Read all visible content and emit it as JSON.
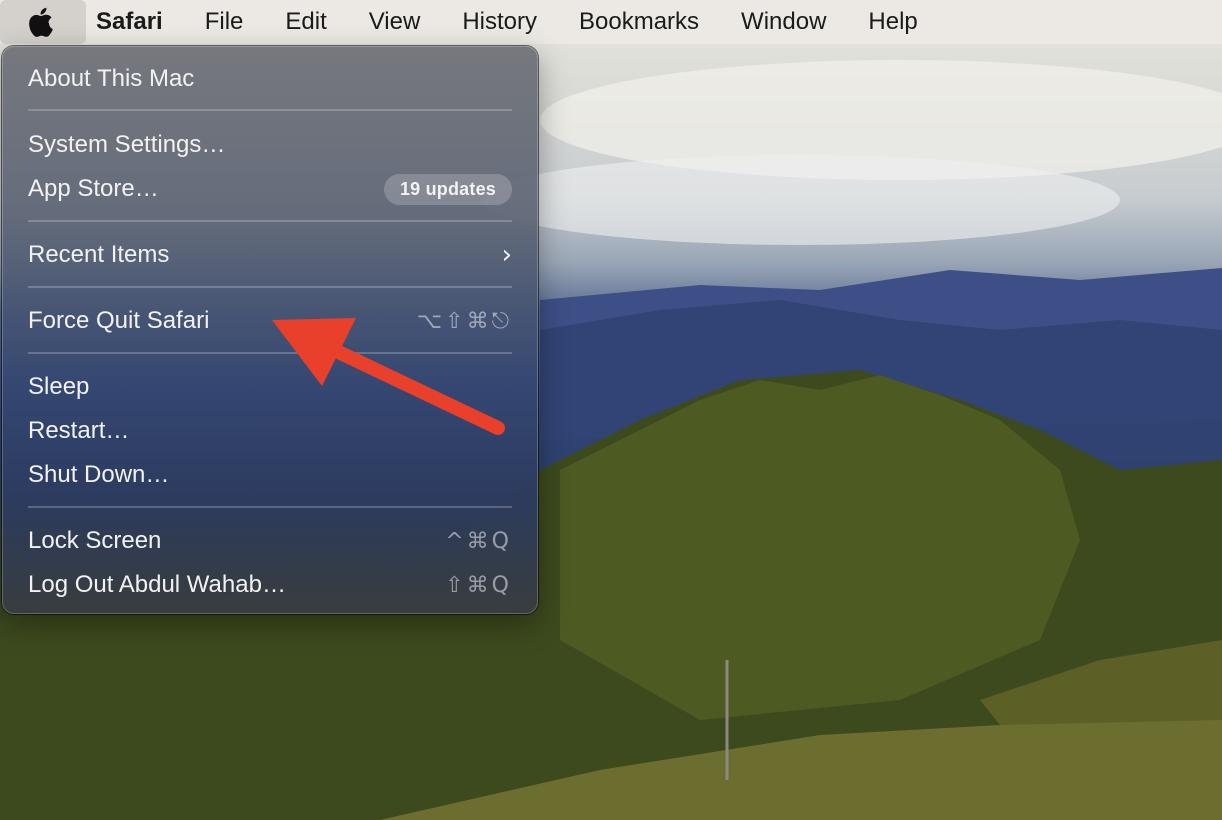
{
  "menubar": {
    "apple_icon": "apple-logo-icon",
    "items": [
      "Safari",
      "File",
      "Edit",
      "View",
      "History",
      "Bookmarks",
      "Window",
      "Help"
    ]
  },
  "apple_menu": {
    "about": "About This Mac",
    "system_settings": "System Settings…",
    "app_store": "App Store…",
    "app_store_badge": "19 updates",
    "recent_items": "Recent Items",
    "force_quit": "Force Quit Safari",
    "force_quit_shortcut": "⌥⇧⌘⎋",
    "sleep": "Sleep",
    "restart": "Restart…",
    "shut_down": "Shut Down…",
    "lock_screen": "Lock Screen",
    "lock_screen_shortcut": "^⌘Q",
    "log_out": "Log Out Abdul Wahab…",
    "log_out_shortcut": "⇧⌘Q"
  },
  "colors": {
    "annotation_arrow": "#e8402a"
  }
}
